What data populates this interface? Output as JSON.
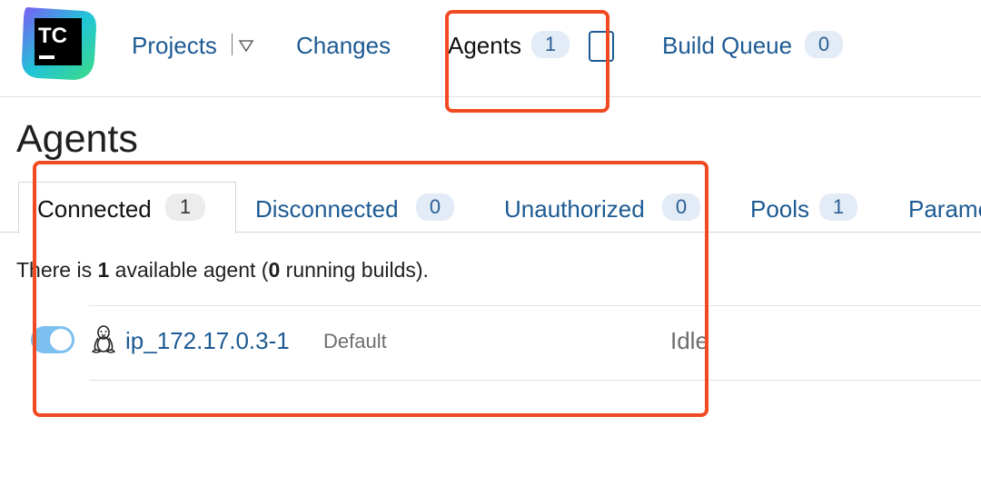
{
  "brand": {
    "logo_text": "TC"
  },
  "nav": {
    "projects_label": "Projects",
    "changes_label": "Changes",
    "agents_label": "Agents",
    "agents_count": "1",
    "build_queue_label": "Build Queue",
    "build_queue_count": "0"
  },
  "page": {
    "title": "Agents"
  },
  "tabs": [
    {
      "label": "Connected",
      "count": "1",
      "active": true
    },
    {
      "label": "Disconnected",
      "count": "0"
    },
    {
      "label": "Unauthorized",
      "count": "0"
    },
    {
      "label": "Pools",
      "count": "1"
    },
    {
      "label": "Parame"
    }
  ],
  "summary": {
    "prefix": "There is ",
    "available_count": "1",
    "middle": " available agent (",
    "running_count": "0",
    "suffix": " running builds)."
  },
  "agents": [
    {
      "name": "ip_172.17.0.3-1",
      "pool": "Default",
      "status": "Idle",
      "enabled": true,
      "os_icon": "linux-tux-icon"
    }
  ],
  "colors": {
    "link": "#1d5a93",
    "badge_bg": "#e2ebf6",
    "annotation": "#f04a23",
    "toggle_on": "#7cc0f0"
  }
}
